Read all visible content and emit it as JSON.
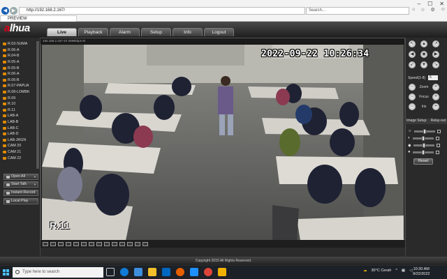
{
  "browser": {
    "url": "http://192.168.2.167/",
    "search_placeholder": "Search...",
    "tab_title": "PREVIEW",
    "back": "◀",
    "forward": "▶"
  },
  "app": {
    "logo_prefix": "a",
    "logo_rest": "lhua",
    "nav_tabs": [
      "Live",
      "Playback",
      "Alarm",
      "Setup",
      "Info",
      "Logout"
    ],
    "active_tab": "Live"
  },
  "cameras": [
    {
      "name": "R.03-SUMA",
      "flag": "M"
    },
    {
      "name": "R.06-A",
      "flag": ""
    },
    {
      "name": "R.04-B",
      "flag": ""
    },
    {
      "name": "R.05-A",
      "flag": "M"
    },
    {
      "name": "R.05-B",
      "flag": "M"
    },
    {
      "name": "R.06-A",
      "flag": "M"
    },
    {
      "name": "R.06-B",
      "flag": "M"
    },
    {
      "name": "R.07-PAPUA",
      "flag": ""
    },
    {
      "name": "R.08-LOMBK",
      "flag": ""
    },
    {
      "name": "R.09",
      "flag": ""
    },
    {
      "name": "R.10",
      "flag": ""
    },
    {
      "name": "R.11",
      "flag": "M"
    },
    {
      "name": "LAB-A",
      "flag": "M"
    },
    {
      "name": "LAB-B",
      "flag": "M"
    },
    {
      "name": "LAB-C",
      "flag": ""
    },
    {
      "name": "LAB-D",
      "flag": ""
    },
    {
      "name": "LAB-JRGN",
      "flag": ""
    },
    {
      "name": "CAM 20",
      "flag": ""
    },
    {
      "name": "CAM 21",
      "flag": ""
    },
    {
      "name": "CAM 22",
      "flag": ""
    }
  ],
  "side_buttons": {
    "open_all": "Open All",
    "start_talk": "Start Talk",
    "instant_record": "Instant Record",
    "local_play": "Local Play"
  },
  "video": {
    "header": "192.168.2.167-1#  2596kbps  M",
    "timestamp": "2022-09-22 10:26:34",
    "camera_label": "R.11"
  },
  "ptz": {
    "speed_label": "Speed(1-8)",
    "speed_value": "5",
    "zoom": "Zoom",
    "focus": "Focus",
    "iris": "Iris"
  },
  "image_setup": {
    "tab_image": "Image Setup",
    "tab_relay": "Relay-out",
    "reset": "Reset",
    "levels": [
      0.5,
      0.5,
      0.5,
      0.5
    ]
  },
  "footer": "Copyright 2015 All Rights Reserved.",
  "taskbar": {
    "search_placeholder": "Type here to search",
    "weather": "30°C  Cerah",
    "time": "10:30 AM",
    "date": "9/22/2022"
  },
  "colors": {
    "brand_red": "#e0001b",
    "camera_icon": "#e08a00"
  }
}
